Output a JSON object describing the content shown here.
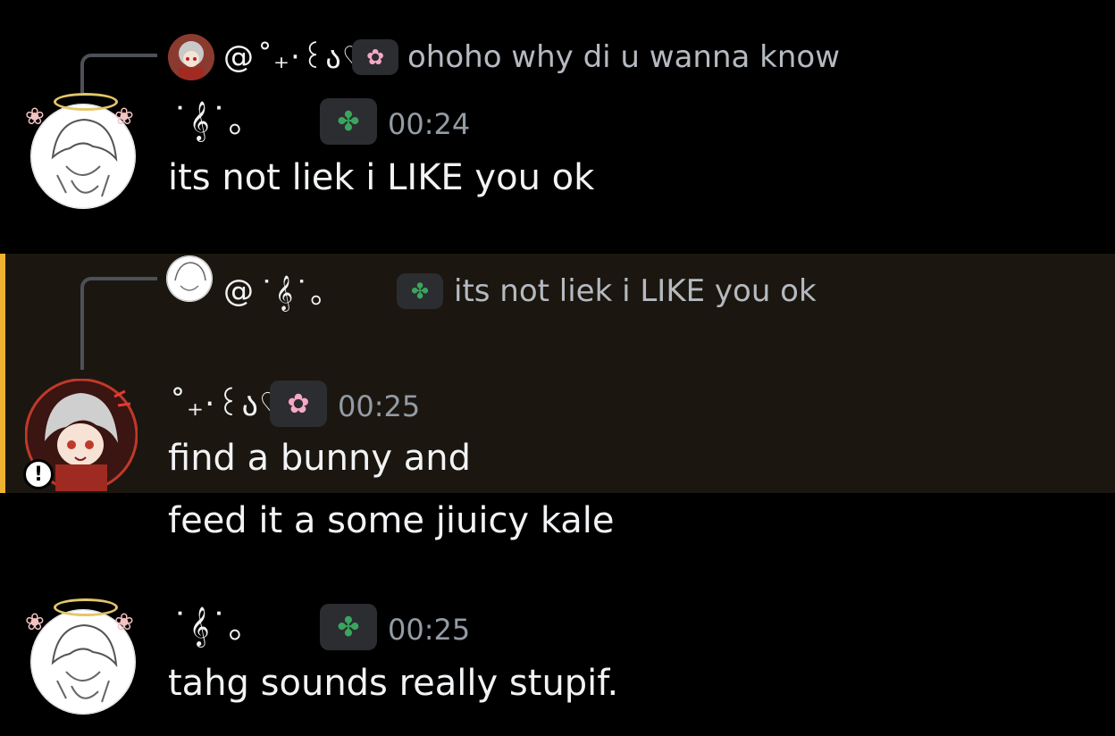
{
  "messages": [
    {
      "reply": {
        "at": "@",
        "name": "˚₊‧꒰ა♡",
        "text": "ohoho why di u wanna know"
      },
      "author": "˙𝄞˙。",
      "time": "00:24",
      "lines": [
        "its not liek i LIKE you ok"
      ]
    },
    {
      "highlighted": true,
      "reply": {
        "at": "@",
        "name": "˙𝄞˙。",
        "text": "its not liek i LIKE you ok"
      },
      "author": "˚₊‧꒰ა♡",
      "time": "00:25",
      "lines": [
        "find a bunny and",
        "feed it a some jiuicy kale"
      ]
    },
    {
      "author": "˙𝄞˙。",
      "time": "00:25",
      "lines": [
        "tahg sounds really stupif."
      ]
    }
  ],
  "icons": {
    "clover": "clover-icon",
    "sakura": "sakura-icon",
    "halo": "halo-icon",
    "alert": "alert-icon"
  },
  "colors": {
    "background": "#000000",
    "highlight_bg": "#1b1710",
    "highlight_bar": "#f0b232",
    "text": "#f2f3f5",
    "muted": "#949ba4",
    "tag_bg": "#2b2d31"
  }
}
